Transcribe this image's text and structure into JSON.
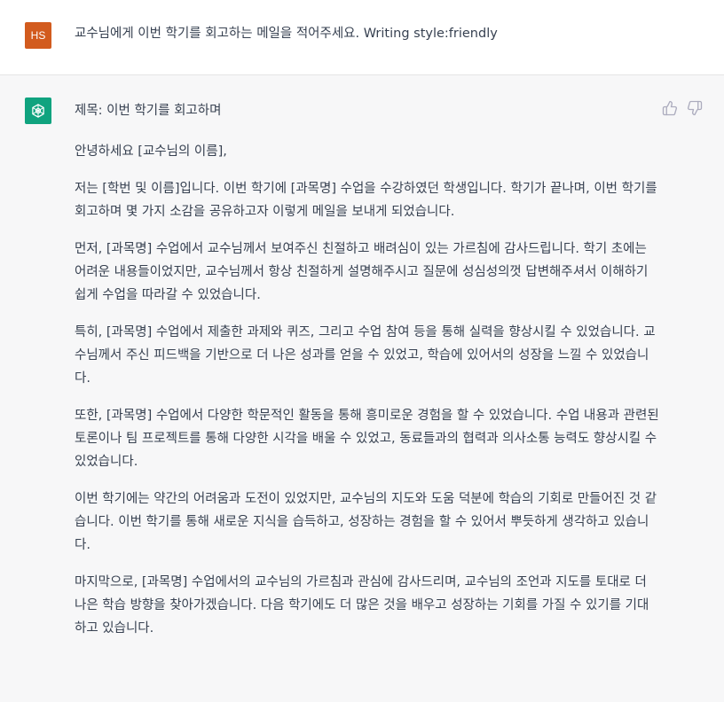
{
  "user_message": {
    "avatar_initials": "HS",
    "avatar_color": "#d25b1e",
    "text": "교수님에게 이번 학기를 회고하는 메일을 적어주세요. Writing style:friendly"
  },
  "assistant_message": {
    "avatar_color": "#10a37f",
    "avatar_icon": "openai-logo-icon",
    "feedback": {
      "thumbs_up_icon": "thumbs-up-icon",
      "thumbs_down_icon": "thumbs-down-icon"
    },
    "paragraphs": [
      "제목: 이번 학기를 회고하며",
      "안녕하세요 [교수님의 이름],",
      "저는 [학번 및 이름]입니다. 이번 학기에 [과목명] 수업을 수강하였던 학생입니다. 학기가 끝나며, 이번 학기를 회고하며 몇 가지 소감을 공유하고자 이렇게 메일을 보내게 되었습니다.",
      "먼저, [과목명] 수업에서 교수님께서 보여주신 친절하고 배려심이 있는 가르침에 감사드립니다. 학기 초에는 어려운 내용들이었지만, 교수님께서 항상 친절하게 설명해주시고 질문에 성심성의껏 답변해주셔서 이해하기 쉽게 수업을 따라갈 수 있었습니다.",
      "특히, [과목명] 수업에서 제출한 과제와 퀴즈, 그리고 수업 참여 등을 통해 실력을 향상시킬 수 있었습니다. 교수님께서 주신 피드백을 기반으로 더 나은 성과를 얻을 수 있었고, 학습에 있어서의 성장을 느낄 수 있었습니다.",
      "또한, [과목명] 수업에서 다양한 학문적인 활동을 통해 흥미로운 경험을 할 수 있었습니다. 수업 내용과 관련된 토론이나 팀 프로젝트를 통해 다양한 시각을 배울 수 있었고, 동료들과의 협력과 의사소통 능력도 향상시킬 수 있었습니다.",
      "이번 학기에는 약간의 어려움과 도전이 있었지만, 교수님의 지도와 도움 덕분에 학습의 기회로 만들어진 것 같습니다. 이번 학기를 통해 새로운 지식을 습득하고, 성장하는 경험을 할 수 있어서 뿌듯하게 생각하고 있습니다.",
      "마지막으로, [과목명] 수업에서의 교수님의 가르침과 관심에 감사드리며, 교수님의 조언과 지도를 토대로 더 나은 학습 방향을 찾아가겠습니다. 다음 학기에도 더 많은 것을 배우고 성장하는 기회를 가질 수 있기를 기대하고 있습니다."
    ]
  }
}
